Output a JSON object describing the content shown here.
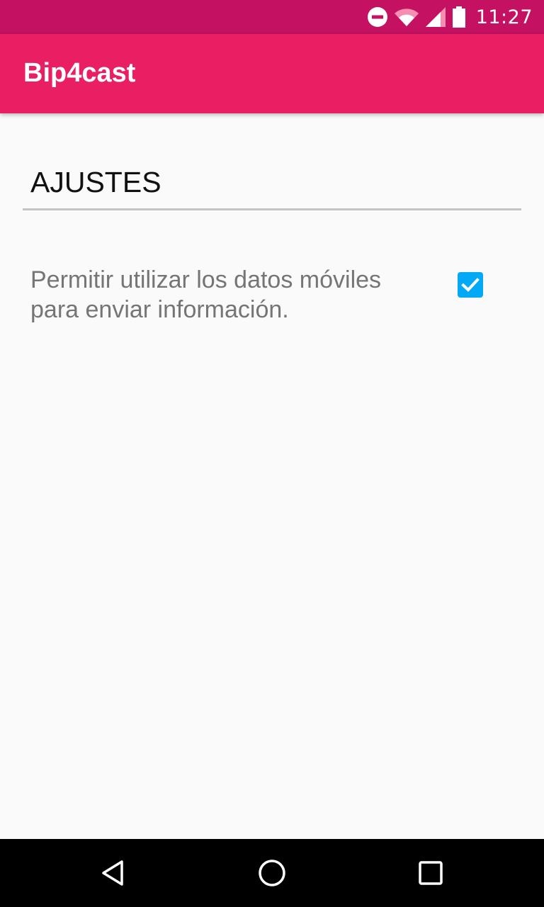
{
  "status_bar": {
    "time": "11:27",
    "icons": [
      "do-not-disturb-icon",
      "wifi-icon",
      "cell-signal-icon",
      "battery-icon"
    ]
  },
  "app_bar": {
    "title": "Bip4cast"
  },
  "settings": {
    "section_title": "AJUSTES",
    "items": [
      {
        "label": "Permitir utilizar los datos móviles para enviar información.",
        "checked": true
      }
    ]
  },
  "navigation_bar": {
    "buttons": [
      "back-icon",
      "home-icon",
      "recents-icon"
    ]
  },
  "colors": {
    "status_bar": "#c51162",
    "app_bar": "#e91e63",
    "checkbox_accent": "#03a9f4",
    "background": "#fafafa"
  }
}
